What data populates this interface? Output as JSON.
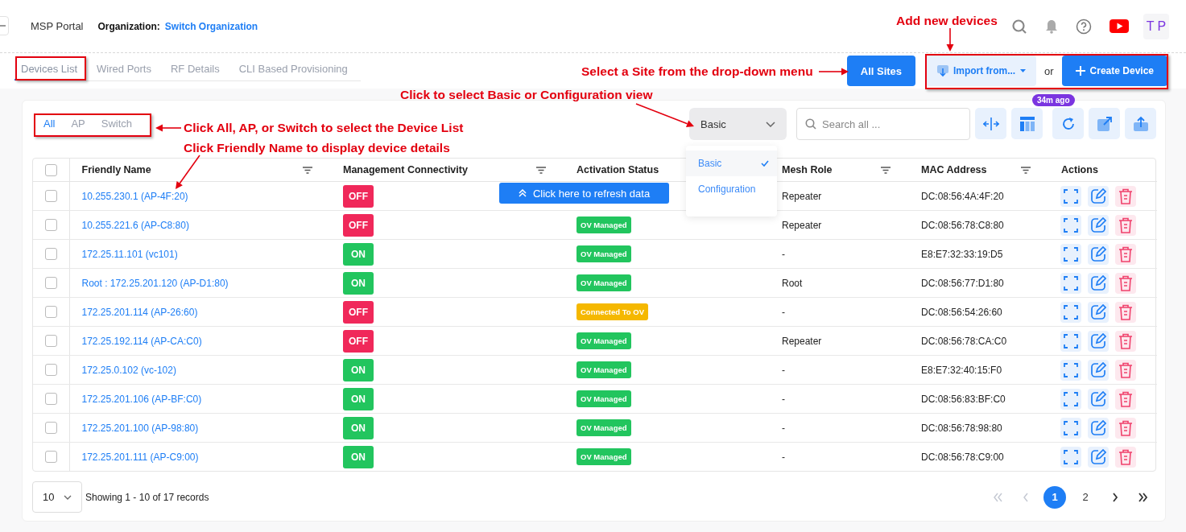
{
  "header": {
    "portal": "MSP Portal",
    "org_label": "Organization:",
    "org_name": "Switch Organization",
    "avatar": "T P"
  },
  "page_tabs": [
    {
      "label": "Devices List",
      "selected": true
    },
    {
      "label": "Wired Ports",
      "selected": false
    },
    {
      "label": "RF Details",
      "selected": false
    },
    {
      "label": "CLI Based Provisioning",
      "selected": false
    }
  ],
  "site_button": "All Sites",
  "import_button": "Import from...",
  "or_text": "or",
  "create_button": "Create Device",
  "device_tabs": [
    {
      "label": "All",
      "selected": true
    },
    {
      "label": "AP",
      "selected": false
    },
    {
      "label": "Switch",
      "selected": false
    }
  ],
  "view_select": {
    "value": "Basic",
    "options": [
      {
        "label": "Basic",
        "selected": true
      },
      {
        "label": "Configuration",
        "selected": false
      }
    ]
  },
  "search": {
    "placeholder": "Search all ..."
  },
  "refresh_badge": "34m ago",
  "refresh_notice": "Click here to refresh data",
  "table": {
    "columns": [
      {
        "label": "Friendly Name",
        "filter": true
      },
      {
        "label": "Management Connectivity",
        "filter": true
      },
      {
        "label": "Activation Status",
        "filter": false
      },
      {
        "label": "Mesh Role",
        "filter": true
      },
      {
        "label": "MAC Address",
        "filter": true
      },
      {
        "label": "Actions",
        "filter": false
      }
    ],
    "header_checked": false,
    "rows": [
      {
        "checked": false,
        "name": "10.255.230.1 (AP-4F:20)",
        "connectivity": {
          "text": "OFF",
          "on": false
        },
        "mesh": "Repeater",
        "mac": "DC:08:56:4A:4F:20"
      },
      {
        "checked": false,
        "name": "10.255.221.6 (AP-C8:80)",
        "connectivity": {
          "text": "OFF",
          "on": false
        },
        "activation": {
          "text": "OV Managed",
          "color": "#22c55e"
        },
        "mesh": "Repeater",
        "mac": "DC:08:56:78:C8:80"
      },
      {
        "checked": false,
        "name": "172.25.11.101 (vc101)",
        "connectivity": {
          "text": "ON",
          "on": true
        },
        "activation": {
          "text": "OV Managed",
          "color": "#22c55e"
        },
        "mesh": "-",
        "mac": "E8:E7:32:33:19:D5"
      },
      {
        "checked": false,
        "name": "Root : 172.25.201.120 (AP-D1:80)",
        "connectivity": {
          "text": "ON",
          "on": true
        },
        "activation": {
          "text": "OV Managed",
          "color": "#22c55e"
        },
        "mesh": "Root",
        "mac": "DC:08:56:77:D1:80"
      },
      {
        "checked": false,
        "name": "172.25.201.114 (AP-26:60)",
        "connectivity": {
          "text": "OFF",
          "on": false
        },
        "activation": {
          "text": "Connected To OV",
          "color": "#f5b800"
        },
        "mesh": "-",
        "mac": "DC:08:56:54:26:60"
      },
      {
        "checked": false,
        "name": "172.25.192.114 (AP-CA:C0)",
        "connectivity": {
          "text": "OFF",
          "on": false
        },
        "activation": {
          "text": "OV Managed",
          "color": "#22c55e"
        },
        "mesh": "Repeater",
        "mac": "DC:08:56:78:CA:C0"
      },
      {
        "checked": false,
        "name": "172.25.0.102 (vc-102)",
        "connectivity": {
          "text": "ON",
          "on": true
        },
        "activation": {
          "text": "OV Managed",
          "color": "#22c55e"
        },
        "mesh": "-",
        "mac": "E8:E7:32:40:15:F0"
      },
      {
        "checked": false,
        "name": "172.25.201.106 (AP-BF:C0)",
        "connectivity": {
          "text": "ON",
          "on": true
        },
        "activation": {
          "text": "OV Managed",
          "color": "#22c55e"
        },
        "mesh": "-",
        "mac": "DC:08:56:83:BF:C0"
      },
      {
        "checked": false,
        "name": "172.25.201.100 (AP-98:80)",
        "connectivity": {
          "text": "ON",
          "on": true
        },
        "activation": {
          "text": "OV Managed",
          "color": "#22c55e"
        },
        "mesh": "-",
        "mac": "DC:08:56:78:98:80"
      },
      {
        "checked": false,
        "name": "172.25.201.111 (AP-C9:00)",
        "connectivity": {
          "text": "ON",
          "on": true
        },
        "activation": {
          "text": "OV Managed",
          "color": "#22c55e"
        },
        "mesh": "-",
        "mac": "DC:08:56:78:C9:00"
      }
    ]
  },
  "footer": {
    "page_size": "10",
    "summary": "Showing 1 - 10 of 17 records",
    "nav": [
      {
        "kind": "first",
        "disabled": true
      },
      {
        "kind": "prev",
        "disabled": true
      },
      {
        "kind": "page",
        "label": "1",
        "selected": true
      },
      {
        "kind": "page",
        "label": "2",
        "selected": false
      },
      {
        "kind": "next",
        "disabled": false
      },
      {
        "kind": "last",
        "disabled": false
      }
    ]
  },
  "annotations": [
    {
      "text": "Add new devices"
    },
    {
      "text": "Select a Site from the drop-down menu"
    },
    {
      "text": "Click to select Basic or Configuration view"
    },
    {
      "text": "Click All, AP, or Switch to select the Device List"
    },
    {
      "text": "Click Friendly Name to display device details"
    }
  ]
}
